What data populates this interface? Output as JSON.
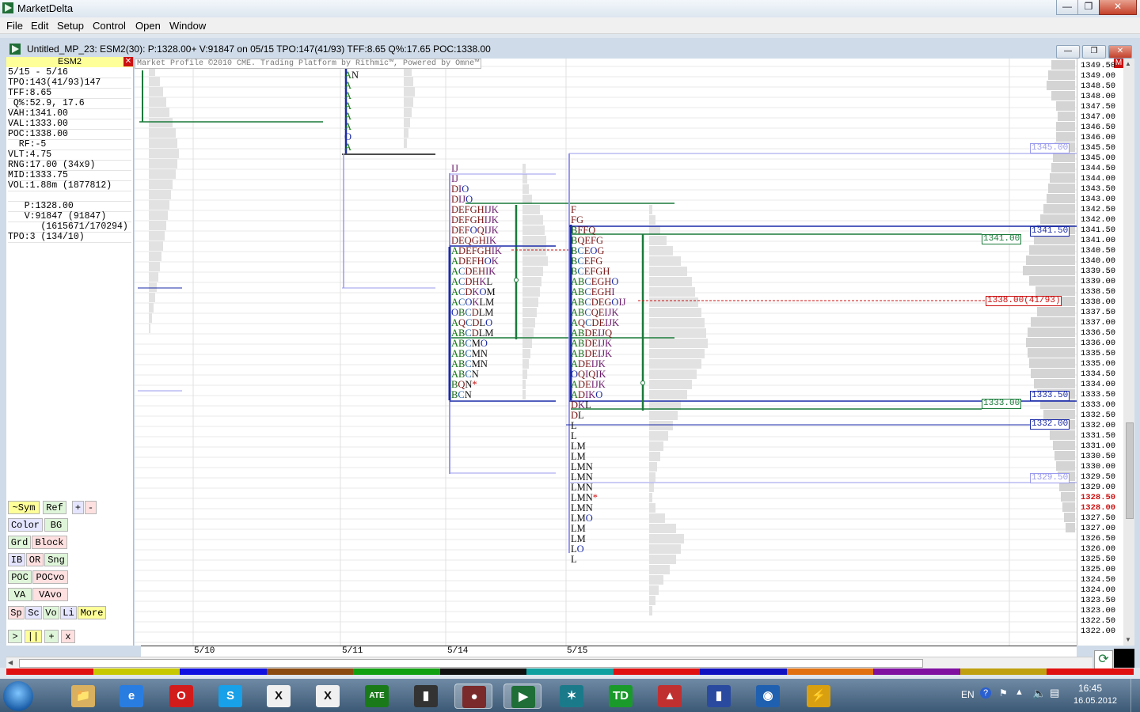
{
  "app": {
    "title": "MarketDelta"
  },
  "menu": [
    "File",
    "Edit",
    "Setup",
    "Control",
    "Open",
    "Window"
  ],
  "window": {
    "caption": "Untitled_MP_23: ESM2(30): P:1328.00+ V:91847 on 05/15 TPO:147(41/93) TFF:8.65 Q%:17.65 POC:1338.00"
  },
  "left_panel": {
    "symbol": "ESM2",
    "stats": [
      "5/15 - 5/16",
      "TPO:143(41/93)147",
      "TFF:8.65",
      " Q%:52.9, 17.6",
      "VAH:1341.00",
      "VAL:1333.00",
      "POC:1338.00",
      "  RF:-5",
      "VLT:4.75",
      "RNG:17.00 (34x9)",
      "MID:1333.75",
      "VOL:1.88m (1877812)",
      "",
      "   P:1328.00",
      "   V:91847 (91847)",
      "      (1615671/170294)",
      "TPO:3 (134/10)"
    ],
    "buttons": {
      "row1": [
        "~Sym",
        "Ref",
        "+",
        "-"
      ],
      "row2": [
        "Color",
        "BG"
      ],
      "row3": [
        "Grd",
        "Block"
      ],
      "row4": [
        "IB",
        "OR",
        "Sng"
      ],
      "row5": [
        "POC",
        "POCvo"
      ],
      "row6": [
        "VA",
        "VAvo"
      ],
      "row7": [
        "Sp",
        "Sc",
        "Vo",
        "Li",
        "More"
      ],
      "row8": [
        ">",
        "||",
        "+",
        "x"
      ]
    }
  },
  "chart": {
    "copyright": "Market Profile ©2010 CME. Trading Platform by Rithmic™, Powered by Omne™",
    "price_ticks": [
      "1349.50",
      "1349.00",
      "1348.50",
      "1348.00",
      "1347.50",
      "1347.00",
      "1346.50",
      "1346.00",
      "1345.50",
      "1345.00",
      "1344.50",
      "1344.00",
      "1343.50",
      "1343.00",
      "1342.50",
      "1342.00",
      "1341.50",
      "1341.00",
      "1340.50",
      "1340.00",
      "1339.50",
      "1339.00",
      "1338.50",
      "1338.00",
      "1337.50",
      "1337.00",
      "1336.50",
      "1336.00",
      "1335.50",
      "1335.00",
      "1334.50",
      "1334.00",
      "1333.50",
      "1333.00",
      "1332.50",
      "1332.00",
      "1331.50",
      "1331.00",
      "1330.50",
      "1330.00",
      "1329.50",
      "1329.00",
      "1328.50",
      "1328.00",
      "1327.50",
      "1327.00",
      "1326.50",
      "1326.00",
      "1325.50",
      "1325.00",
      "1324.50",
      "1324.00",
      "1323.50",
      "1323.00",
      "1322.50",
      "1322.00"
    ],
    "highlight_prices": [
      "1328.50",
      "1328.00"
    ],
    "dates": [
      "5/10",
      "5/11",
      "5/14",
      "5/15"
    ],
    "labels": {
      "p1345": "1345.00",
      "p1341_5": "1341.50",
      "p1341": "1341.00",
      "p1338": "1338.00(41/93)",
      "p1333_5": "1333.50",
      "p1333": "1333.00",
      "p1332": "1332.00",
      "p1329_5": "1329.50"
    },
    "profile_5_11": [
      "AN",
      "A",
      "A",
      "A",
      "A",
      "A",
      "O",
      "A"
    ],
    "profile_5_14": [
      "IJ",
      "IJ",
      "DIO",
      "DIJO",
      "DEFGHIJK",
      "DEFGHIJK",
      "DEFOQIJK",
      "DEQGHIK",
      "ADEFGHIK",
      "ADEFHOK",
      "ACDEHIK",
      "ACDHKL",
      "ACDKOM",
      "ACOKLM",
      "OBCDLM",
      "AQCDLO",
      "ABCDLM",
      "ABCMO",
      "ABCMN",
      "ABCMN",
      "ABCN",
      "BQN*",
      "BCN"
    ],
    "profile_5_15": [
      "F",
      "FG",
      "BFFQ",
      "BQEFG",
      "BCEOG",
      "BCEFG",
      "BCEFGH",
      "ABCEGHO",
      "ABCEGHI",
      "ABCDEGOIJ",
      "ABCQEIJK",
      "AQCDEIJK",
      "ABDEIJQ",
      "ABDEIJK",
      "ABDEIJK",
      "ADEIJK",
      "OQIQIK",
      "ADEIJK",
      "ADIKO",
      "DKL",
      "DL",
      "L",
      "L",
      "LM",
      "LM",
      "LMN",
      "LMN",
      "LMN",
      "LMN*",
      "LMN",
      "LMO",
      "LM",
      "LM",
      "LO",
      "L"
    ]
  },
  "taskbar": {
    "icons": [
      "explorer-icon",
      "internet-explorer-icon",
      "opera-icon",
      "skype-icon",
      "x-trader-icon",
      "xtrader-pro-icon",
      "ate-icon",
      "usb-icon",
      "app-icon",
      "marketdelta-icon",
      "sparkle-icon",
      "td-icon",
      "chart-app-icon",
      "bars-app-icon",
      "globe-app-icon",
      "tool-app-icon"
    ],
    "lang": "EN",
    "time": "16:45",
    "date": "16.05.2012"
  },
  "colors": {
    "accent": "#1f6e37",
    "value_area": "#1a7a3a",
    "initial_balance": "#2233cc",
    "poc": "#cc1111"
  }
}
